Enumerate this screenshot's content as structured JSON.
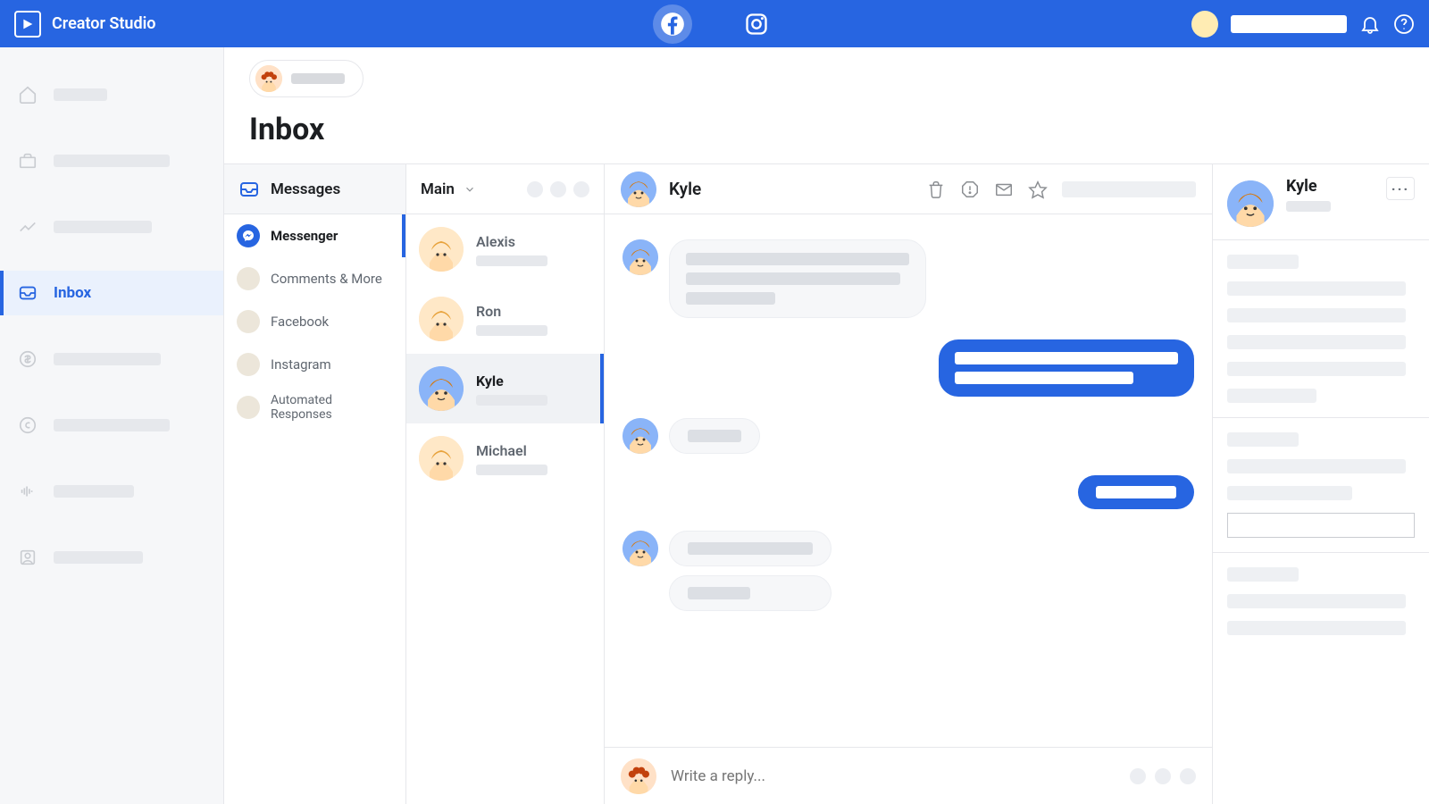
{
  "header": {
    "app_title": "Creator Studio",
    "platforms": {
      "facebook_active": true
    }
  },
  "nav": {
    "active_label": "Inbox",
    "items_count": 8
  },
  "page": {
    "title": "Inbox"
  },
  "categories": {
    "header": "Messages",
    "items": [
      {
        "label": "Messenger",
        "active": true,
        "icon": "messenger"
      },
      {
        "label": "Comments & More",
        "active": false,
        "icon": "gray"
      },
      {
        "label": "Facebook",
        "active": false,
        "icon": "gray"
      },
      {
        "label": "Instagram",
        "active": false,
        "icon": "gray"
      },
      {
        "label": "Automated Responses",
        "active": false,
        "icon": "gray"
      }
    ]
  },
  "threads": {
    "folder": "Main",
    "list": [
      {
        "name": "Alexis",
        "avatar": "cream",
        "active": false
      },
      {
        "name": "Ron",
        "avatar": "brown",
        "active": false
      },
      {
        "name": "Kyle",
        "avatar": "kyle",
        "active": true
      },
      {
        "name": "Michael",
        "avatar": "brown",
        "active": false
      }
    ]
  },
  "conversation": {
    "contact_name": "Kyle",
    "compose_placeholder": "Write a reply..."
  },
  "right_panel": {
    "contact_name": "Kyle",
    "more_label": "···"
  }
}
